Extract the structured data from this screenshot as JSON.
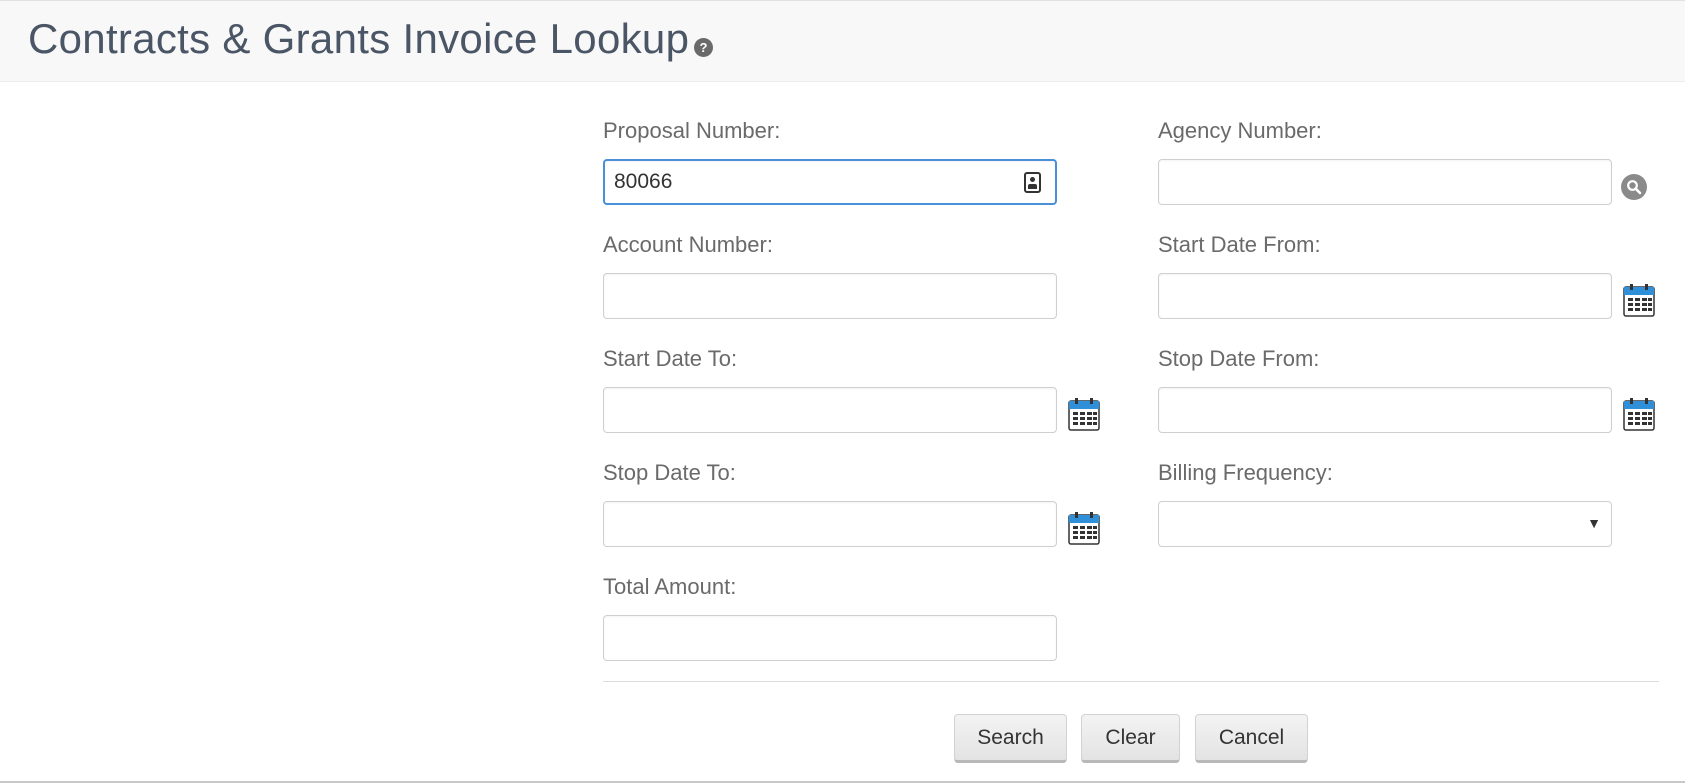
{
  "header": {
    "title": "Contracts & Grants Invoice Lookup",
    "help_glyph": "?"
  },
  "form": {
    "proposal_number": {
      "label": "Proposal Number:",
      "value": "80066"
    },
    "agency_number": {
      "label": "Agency Number:",
      "value": ""
    },
    "account_number": {
      "label": "Account Number:",
      "value": ""
    },
    "start_date_from": {
      "label": "Start Date From:",
      "value": ""
    },
    "start_date_to": {
      "label": "Start Date To:",
      "value": ""
    },
    "stop_date_from": {
      "label": "Stop Date From:",
      "value": ""
    },
    "stop_date_to": {
      "label": "Stop Date To:",
      "value": ""
    },
    "billing_frequency": {
      "label": "Billing Frequency:",
      "value": "",
      "arrow": "▼"
    },
    "total_amount": {
      "label": "Total Amount:",
      "value": ""
    }
  },
  "buttons": {
    "search": "Search",
    "clear": "Clear",
    "cancel": "Cancel"
  },
  "icons": {
    "help": "help-icon",
    "contact_card": "contact-card-icon",
    "lookup": "magnifier-icon",
    "calendar": "calendar-icon"
  },
  "colors": {
    "focus_border": "#4a90d9",
    "title_text": "#4a5565",
    "calendar_header": "#2f8fd8"
  }
}
